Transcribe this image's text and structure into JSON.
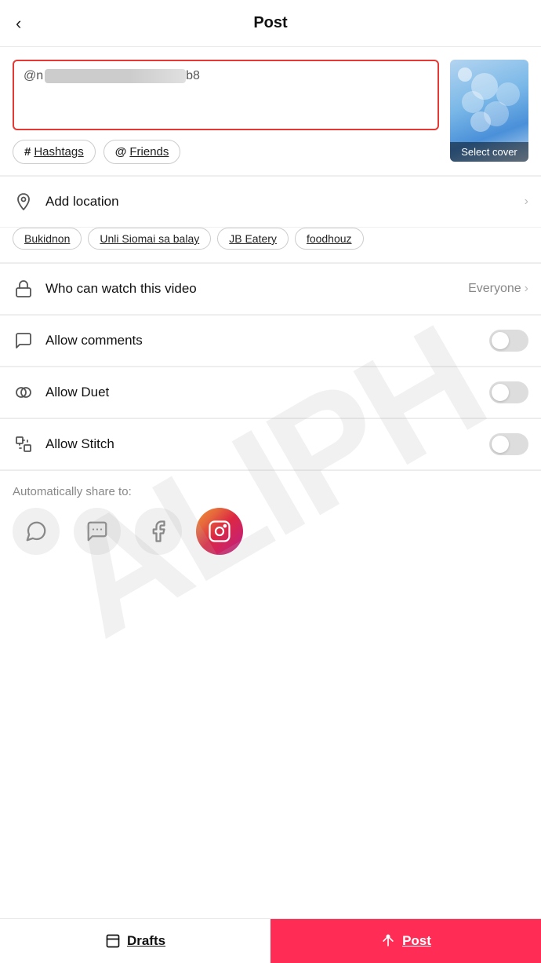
{
  "header": {
    "back_label": "‹",
    "title": "Post"
  },
  "caption": {
    "prefix": "@n",
    "redacted": true,
    "suffix": "b8",
    "placeholder": "@n...b8"
  },
  "cover": {
    "label": "Select cover"
  },
  "tags": {
    "hashtags_label": "Hashtags",
    "hashtags_icon": "#",
    "friends_label": "Friends",
    "friends_icon": "@"
  },
  "location": {
    "label": "Add location",
    "tags": [
      "Bukidnon",
      "Unli Siomai sa balay",
      "JB Eatery",
      "foodhouz"
    ]
  },
  "privacy": {
    "label": "Who can watch this video",
    "value": "Everyone"
  },
  "comments": {
    "label": "Allow comments",
    "enabled": false
  },
  "duet": {
    "label": "Allow Duet",
    "enabled": false
  },
  "stitch": {
    "label": "Allow Stitch",
    "enabled": false
  },
  "share": {
    "label": "Automatically share to:",
    "platforms": [
      "whatsapp",
      "messenger",
      "facebook",
      "instagram"
    ]
  },
  "footer": {
    "drafts_label": "Drafts",
    "post_label": "Post"
  }
}
